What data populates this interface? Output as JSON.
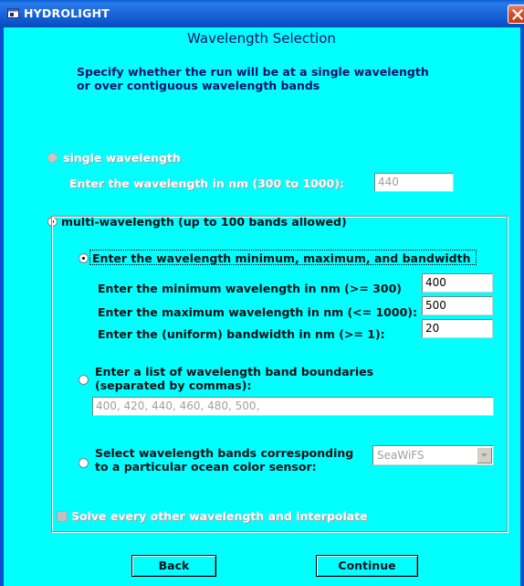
{
  "window": {
    "title": "HYDROLIGHT"
  },
  "heading": "Wavelength  Selection",
  "instructions": {
    "line1": "Specify whether the run will be at a single wavelength",
    "line2": "or over contiguous wavelength bands"
  },
  "single": {
    "label": "single wavelength",
    "prompt": "Enter the wavelength in nm (300 to 1000):",
    "value": "440",
    "selected": false,
    "enabled": false
  },
  "multi": {
    "label": "multi-wavelength (up to 100 bands allowed)",
    "selected": true
  },
  "option_minmax": {
    "label": "Enter the wavelength minimum, maximum, and bandwidth",
    "selected": true,
    "min_label": "Enter the minimum wavelength in nm (>= 300)",
    "min_value": "400",
    "max_label": "Enter the maximum wavelength in nm (<= 1000):",
    "max_value": "500",
    "bw_label": "Enter the (uniform) bandwidth in nm (>= 1):",
    "bw_value": "20"
  },
  "option_list": {
    "label1": "Enter a list of wavelength band boundaries",
    "label2": "(separated by commas):",
    "value": "400, 420, 440, 460, 480, 500,",
    "selected": false
  },
  "option_sensor": {
    "label1": "Select wavelength bands corresponding",
    "label2": "to a particular ocean color sensor:",
    "selected_value": "SeaWiFS",
    "selected": false
  },
  "interpolate": {
    "label": "Solve every other wavelength and interpolate",
    "checked": false,
    "enabled": false
  },
  "buttons": {
    "back": "Back",
    "continue": "Continue"
  },
  "colors": {
    "client_bg": "#00ffff",
    "titlebar": "#0a5fd6",
    "close": "#d2522e",
    "text": "#0c0c6a"
  },
  "icons": {
    "title": "app-window-icon",
    "close": "close-x-icon",
    "dropdown": "chevron-down-icon"
  }
}
